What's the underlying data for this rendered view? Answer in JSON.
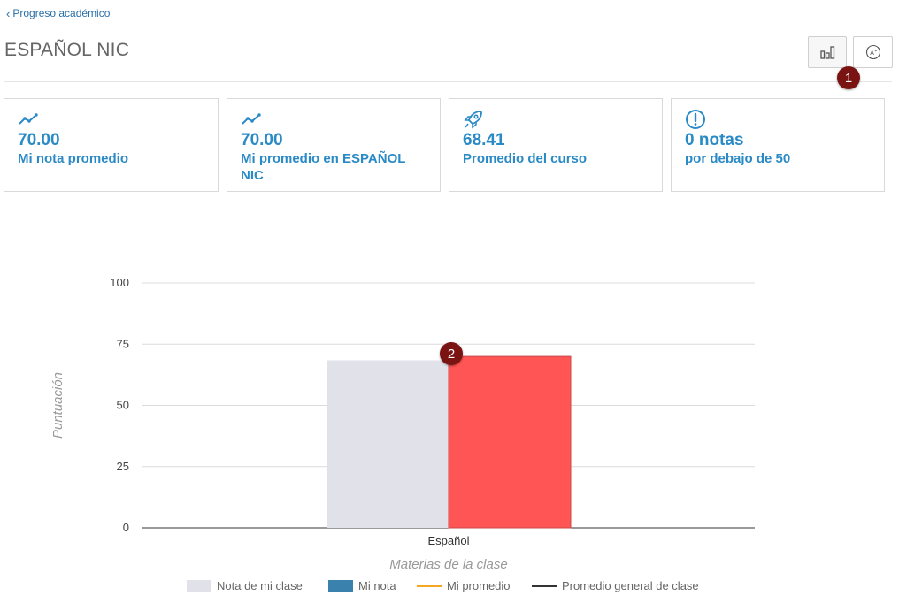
{
  "nav": {
    "back_label": "Progreso académico"
  },
  "header": {
    "title": "ESPAÑOL NIC"
  },
  "cards": [
    {
      "value": "70.00",
      "label": "Mi nota promedio",
      "icon": "trend-line-icon"
    },
    {
      "value": "70.00",
      "label": "Mi promedio en ESPAÑOL NIC",
      "icon": "trend-line-icon"
    },
    {
      "value": "68.41",
      "label": "Promedio del curso",
      "icon": "rocket-icon"
    },
    {
      "value": "0 notas",
      "label": "por debajo de 50",
      "icon": "alert-circle-icon"
    }
  ],
  "badges": {
    "one": "1",
    "two": "2"
  },
  "colors": {
    "accent": "#2a8ac6",
    "class_bar": "#e1e1ea",
    "my_bar": "#ff5555",
    "my_grade_legend": "#3a82ad",
    "my_avg_line": "#f5a623",
    "class_avg_line": "#333333"
  },
  "chart_data": {
    "type": "bar",
    "categories": [
      "Español"
    ],
    "series": [
      {
        "name": "Nota de mi clase",
        "values": [
          68.41
        ],
        "color": "#e1e1ea"
      },
      {
        "name": "Mi nota",
        "values": [
          70.0
        ],
        "color": "#ff5555"
      }
    ],
    "legend": [
      {
        "name": "Nota de mi clase",
        "kind": "rect",
        "color": "#e1e1ea"
      },
      {
        "name": "Mi nota",
        "kind": "rect",
        "color": "#3a82ad"
      },
      {
        "name": "Mi promedio",
        "kind": "line",
        "color": "#f5a623"
      },
      {
        "name": "Promedio general de clase",
        "kind": "line",
        "color": "#333333"
      }
    ],
    "xlabel": "Materias de la clase",
    "ylabel": "Puntuación",
    "ylim": [
      0,
      100
    ],
    "yticks": [
      0,
      25,
      50,
      75,
      100
    ],
    "grid": true,
    "legend_position": "bottom"
  }
}
